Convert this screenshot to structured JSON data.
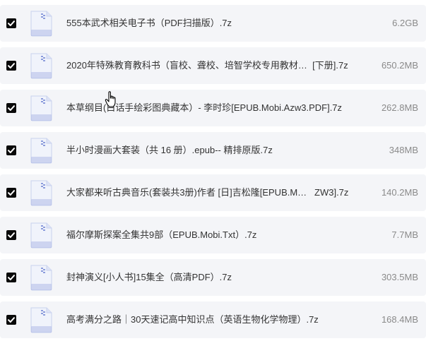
{
  "files": [
    {
      "name": "555本武术相关电子书（PDF扫描版）.7z",
      "size": "6.2GB",
      "checked": true
    },
    {
      "name": "2020年特殊教育教科书（盲校、聋校、培智学校专用教材…  [下册].7z",
      "size": "650.2MB",
      "checked": true
    },
    {
      "name": "本草纲目(白话手绘彩图典藏本）- 李时珍[EPUB.Mobi.Azw3.PDF].7z",
      "size": "262.8MB",
      "checked": true
    },
    {
      "name": "半小时漫画大套装（共 16 册）.epub-- 精排原版.7z",
      "size": "348MB",
      "checked": true
    },
    {
      "name": "大家都来听古典音乐(套装共3册)作者 [日]吉松隆[EPUB.M…   ZW3].7z",
      "size": "140.2MB",
      "checked": true
    },
    {
      "name": "福尔摩斯探案全集共9部（EPUB.Mobi.Txt）.7z",
      "size": "7.7MB",
      "checked": true
    },
    {
      "name": "封神演义[小人书]15集全（高清PDF）.7z",
      "size": "303.5MB",
      "checked": true
    },
    {
      "name": "高考满分之路｜30天速记高中知识点（英语生物化学物理）.7z",
      "size": "168.4MB",
      "checked": true
    }
  ],
  "icons": {
    "checkbox": "checkbox-checked-icon",
    "file": "zip-file-icon",
    "cursor": "hand-pointer-icon"
  },
  "colors": {
    "row_background": "#f4f5f8",
    "checkbox": "#0a0a0a",
    "file_icon_body": "#f0f3fb",
    "file_icon_accent": "#8c9cdc",
    "name_text": "#333333",
    "size_text": "#8a8a8a"
  }
}
